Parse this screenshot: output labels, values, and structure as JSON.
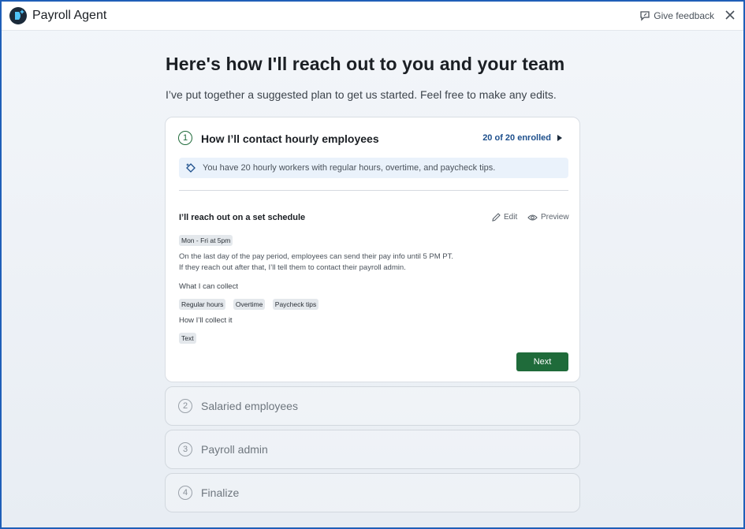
{
  "app": {
    "title": "Payroll Agent",
    "feedback_label": "Give feedback"
  },
  "page": {
    "headline": "Here's how I'll reach out to you and your team",
    "subhead": "I’ve put together a suggested plan to get us started. Feel free to make any edits."
  },
  "active_step": {
    "number": "1",
    "title": "How I’ll contact hourly employees",
    "enrolled": "20 of 20 enrolled",
    "info": "You have 20 hourly workers with regular hours, overtime, and paycheck tips.",
    "schedule_title": "I’ll reach out on a set schedule",
    "edit_label": "Edit",
    "preview_label": "Preview",
    "schedule_chip": "Mon - Fri at 5pm",
    "description_line1": "On the last day of the pay period, employees can send their pay info until 5 PM PT.",
    "description_line2": "If they reach out after that, I’ll tell them to contact their payroll admin.",
    "collect_label": "What I can collect",
    "collect_items": [
      "Regular hours",
      "Overtime",
      "Paycheck tips"
    ],
    "method_label": "How I’ll collect it",
    "method_items": [
      "Text"
    ],
    "next_label": "Next"
  },
  "steps": [
    {
      "number": "2",
      "title": "Salaried employees"
    },
    {
      "number": "3",
      "title": "Payroll admin"
    },
    {
      "number": "4",
      "title": "Finalize"
    }
  ],
  "colors": {
    "brand_green": "#1f6b3a",
    "link_blue": "#1d4f8c",
    "frame_border": "#1f5fb8"
  }
}
